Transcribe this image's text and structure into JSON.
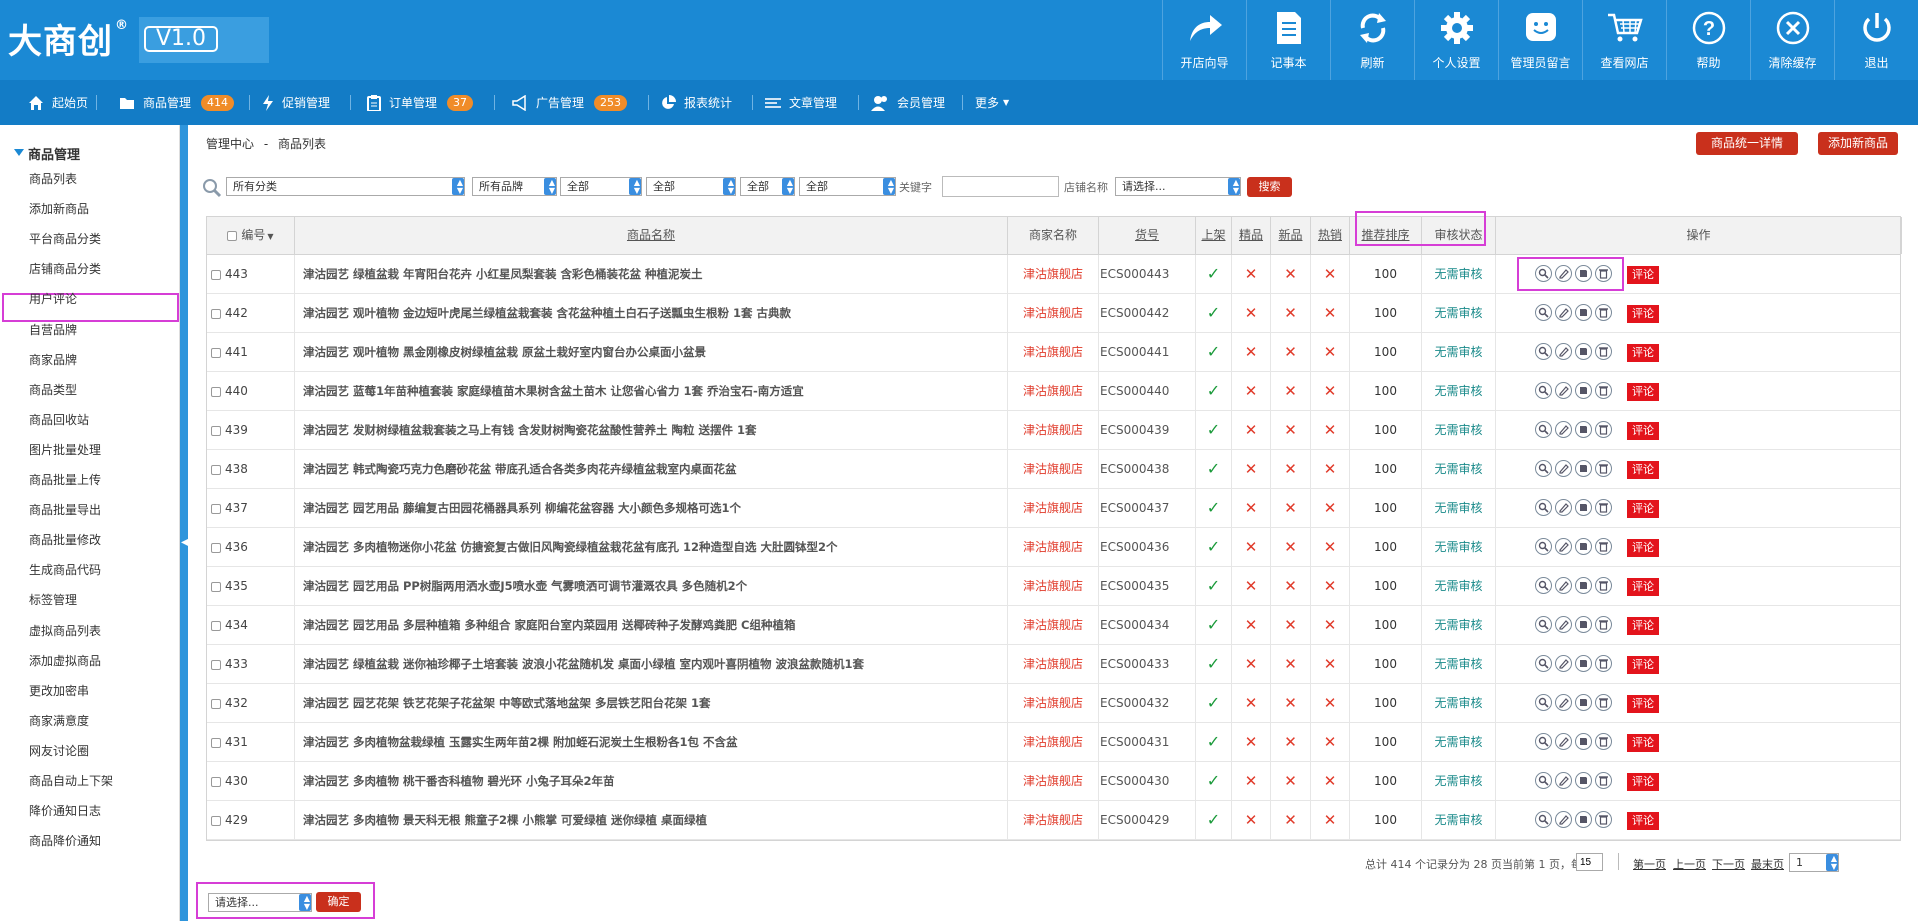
{
  "app": {
    "logo": "大商创",
    "reg": "®",
    "version": "V1.0"
  },
  "toolbar": [
    {
      "label": "开店向导",
      "icon": "share-arrow-icon"
    },
    {
      "label": "记事本",
      "icon": "notepad-icon"
    },
    {
      "label": "刷新",
      "icon": "refresh-icon"
    },
    {
      "label": "个人设置",
      "icon": "gear-icon"
    },
    {
      "label": "管理员留言",
      "icon": "smiley-message-icon"
    },
    {
      "label": "查看网店",
      "icon": "cart-icon"
    },
    {
      "label": "帮助",
      "icon": "help-icon"
    },
    {
      "label": "清除缓存",
      "icon": "clear-icon"
    },
    {
      "label": "退出",
      "icon": "power-icon"
    }
  ],
  "nav": [
    {
      "label": "起始页",
      "icon": "home-icon"
    },
    {
      "label": "商品管理",
      "icon": "folder-icon",
      "badge": "414"
    },
    {
      "label": "促销管理",
      "icon": "lightning-icon"
    },
    {
      "label": "订单管理",
      "icon": "clipboard-icon",
      "badge": "37"
    },
    {
      "label": "广告管理",
      "icon": "megaphone-icon",
      "badge": "253"
    },
    {
      "label": "报表统计",
      "icon": "pie-chart-icon"
    },
    {
      "label": "文章管理",
      "icon": "list-icon"
    },
    {
      "label": "会员管理",
      "icon": "users-icon"
    },
    {
      "label": "更多",
      "icon": "caret-down-icon"
    }
  ],
  "sidebar": {
    "title": "商品管理",
    "items": [
      "商品列表",
      "添加新商品",
      "平台商品分类",
      "店铺商品分类",
      "用户评论",
      "自营品牌",
      "商家品牌",
      "商品类型",
      "商品回收站",
      "图片批量处理",
      "商品批量上传",
      "商品批量导出",
      "商品批量修改",
      "生成商品代码",
      "标签管理",
      "虚拟商品列表",
      "添加虚拟商品",
      "更改加密串",
      "商家满意度",
      "网友讨论圈",
      "商品自动上下架",
      "降价通知日志",
      "商品降价通知"
    ]
  },
  "breadcrumb": {
    "root": "管理中心",
    "sep": "-",
    "current": "商品列表"
  },
  "actions": {
    "unify": "商品统一详情",
    "add": "添加新商品"
  },
  "filters": {
    "category": "所有分类",
    "brand": "所有品牌",
    "s1": "全部",
    "s2": "全部",
    "s3": "全部",
    "s4": "全部",
    "keyword_label": "关键字",
    "keyword_value": "",
    "shop_label": "店铺名称",
    "shop_value": "请选择...",
    "search": "搜索"
  },
  "table": {
    "headers": {
      "id": "编号",
      "name": "商品名称",
      "shop": "商家名称",
      "sn": "货号",
      "onsale": "上架",
      "best": "精品",
      "new": "新品",
      "hot": "热销",
      "sort": "推荐排序",
      "audit": "审核状态",
      "ops": "操作"
    },
    "comment_label": "评论",
    "yes_symbol": "✓",
    "no_symbol": "✕",
    "rows": [
      {
        "id": "443",
        "name": "津沽园艺 绿植盆栽 年宵阳台花卉 小红星凤梨套装 含彩色桶装花盆 种植泥炭土",
        "shop": "津沽旗舰店",
        "sn": "ECS000443",
        "sort": "100",
        "audit": "无需审核"
      },
      {
        "id": "442",
        "name": "津沽园艺 观叶植物 金边短叶虎尾兰绿植盆栽套装 含花盆种植土白石子送瓢虫生根粉 1套 古典款",
        "shop": "津沽旗舰店",
        "sn": "ECS000442",
        "sort": "100",
        "audit": "无需审核"
      },
      {
        "id": "441",
        "name": "津沽园艺 观叶植物 黑金刚橡皮树绿植盆栽 原盆土栽好室内窗台办公桌面小盆景",
        "shop": "津沽旗舰店",
        "sn": "ECS000441",
        "sort": "100",
        "audit": "无需审核"
      },
      {
        "id": "440",
        "name": "津沽园艺 蓝莓1年苗种植套装 家庭绿植苗木果树含盆土苗木 让您省心省力 1套 乔治宝石-南方适宜",
        "shop": "津沽旗舰店",
        "sn": "ECS000440",
        "sort": "100",
        "audit": "无需审核"
      },
      {
        "id": "439",
        "name": "津沽园艺 发财树绿植盆栽套装之马上有钱 含发财树陶瓷花盆酸性营养土 陶粒 送摆件 1套",
        "shop": "津沽旗舰店",
        "sn": "ECS000439",
        "sort": "100",
        "audit": "无需审核"
      },
      {
        "id": "438",
        "name": "津沽园艺 韩式陶瓷巧克力色磨砂花盆 带底孔适合各类多肉花卉绿植盆栽室内桌面花盆",
        "shop": "津沽旗舰店",
        "sn": "ECS000438",
        "sort": "100",
        "audit": "无需审核"
      },
      {
        "id": "437",
        "name": "津沽园艺 园艺用品 藤编复古田园花桶器具系列 柳编花盆容器 大小颜色多规格可选1个",
        "shop": "津沽旗舰店",
        "sn": "ECS000437",
        "sort": "100",
        "audit": "无需审核"
      },
      {
        "id": "436",
        "name": "津沽园艺 多肉植物迷你小花盆 仿搪瓷复古做旧风陶瓷绿植盆栽花盆有底孔 12种造型自选 大肚圆钵型2个",
        "shop": "津沽旗舰店",
        "sn": "ECS000436",
        "sort": "100",
        "audit": "无需审核"
      },
      {
        "id": "435",
        "name": "津沽园艺 园艺用品 PP树脂两用洒水壶J5喷水壶 气雾喷洒可调节灌溉农具 多色随机2个",
        "shop": "津沽旗舰店",
        "sn": "ECS000435",
        "sort": "100",
        "audit": "无需审核"
      },
      {
        "id": "434",
        "name": "津沽园艺 园艺用品 多层种植箱 多种组合 家庭阳台室内菜园用 送椰砖种子发酵鸡粪肥 C组种植箱",
        "shop": "津沽旗舰店",
        "sn": "ECS000434",
        "sort": "100",
        "audit": "无需审核"
      },
      {
        "id": "433",
        "name": "津沽园艺 绿植盆栽 迷你袖珍椰子土培套装 波浪小花盆随机发 桌面小绿植 室内观叶喜阴植物 波浪盆款随机1套",
        "shop": "津沽旗舰店",
        "sn": "ECS000433",
        "sort": "100",
        "audit": "无需审核"
      },
      {
        "id": "432",
        "name": "津沽园艺 园艺花架 铁艺花架子花盆架 中等欧式落地盆架 多层铁艺阳台花架 1套",
        "shop": "津沽旗舰店",
        "sn": "ECS000432",
        "sort": "100",
        "audit": "无需审核"
      },
      {
        "id": "431",
        "name": "津沽园艺 多肉植物盆栽绿植 玉露实生两年苗2棵 附加蛭石泥炭土生根粉各1包 不含盆",
        "shop": "津沽旗舰店",
        "sn": "ECS000431",
        "sort": "100",
        "audit": "无需审核"
      },
      {
        "id": "430",
        "name": "津沽园艺 多肉植物 桃干番杏科植物 碧光环 小兔子耳朵2年苗",
        "shop": "津沽旗舰店",
        "sn": "ECS000430",
        "sort": "100",
        "audit": "无需审核"
      },
      {
        "id": "429",
        "name": "津沽园艺 多肉植物 景天科无根 熊童子2棵 小熊掌 可爱绿植 迷你绿植 桌面绿植",
        "shop": "津沽旗舰店",
        "sn": "ECS000429",
        "sort": "100",
        "audit": "无需审核"
      }
    ]
  },
  "pager": {
    "summary": "总计 414 个记录分为 28 页当前第 1 页，每页",
    "per_page": "15",
    "first": "第一页",
    "prev": "上一页",
    "next": "下一页",
    "last": "最末页",
    "page": "1"
  },
  "batch": {
    "select": "请选择...",
    "confirm": "确定"
  },
  "colors": {
    "header": "#1b89d4",
    "nav": "#137cc6",
    "badge": "#f08c28",
    "danger": "#c9301c",
    "highlight": "#d63ed6"
  }
}
